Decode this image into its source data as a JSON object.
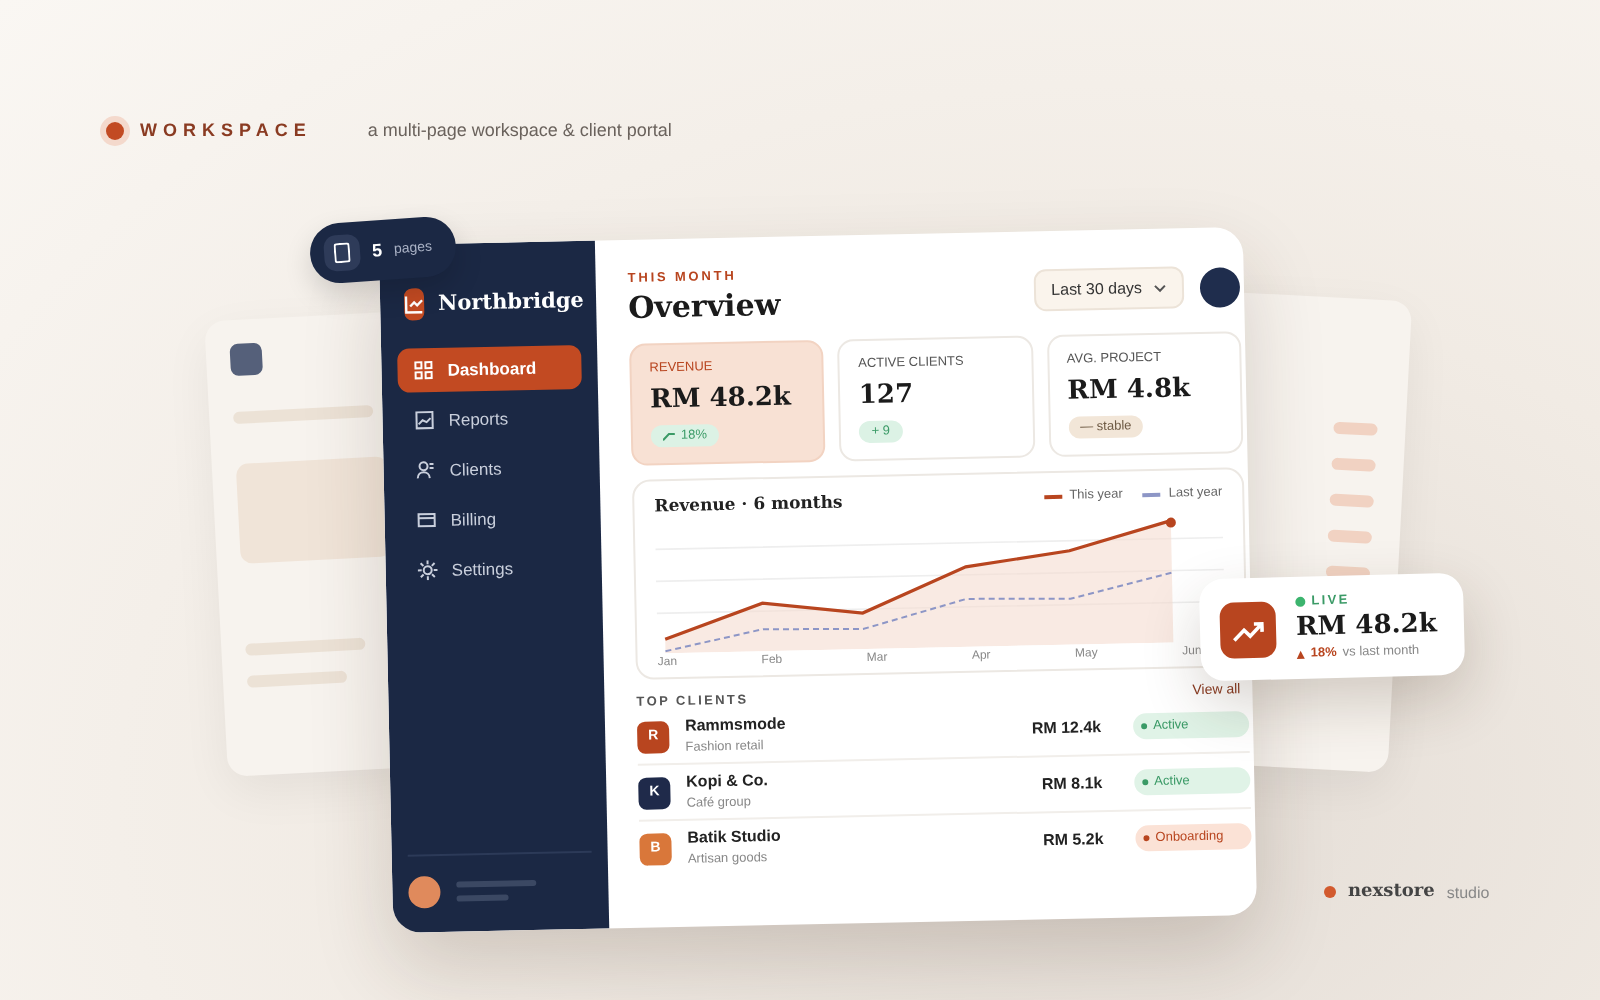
{
  "brand": {
    "label": "WORKSPACE",
    "tagline": "a multi-page workspace & client portal"
  },
  "pages_badge": {
    "count": "5",
    "label": "pages"
  },
  "app": {
    "name": "Northbridge",
    "nav": [
      {
        "label": "Dashboard",
        "selected": true
      },
      {
        "label": "Reports",
        "selected": false
      },
      {
        "label": "Clients",
        "selected": false
      },
      {
        "label": "Billing",
        "selected": false
      },
      {
        "label": "Settings",
        "selected": false
      }
    ]
  },
  "header": {
    "eyebrow": "THIS MONTH",
    "title": "Overview",
    "range": "Last 30 days"
  },
  "kpis": [
    {
      "label": "REVENUE",
      "value": "RM 48.2k",
      "badge": "18%",
      "kind": "up",
      "highlighted": true
    },
    {
      "label": "ACTIVE CLIENTS",
      "value": "127",
      "badge": "+ 9",
      "kind": "plus",
      "highlighted": false
    },
    {
      "label": "AVG. PROJECT",
      "value": "RM 4.8k",
      "badge": "— stable",
      "kind": "flat",
      "highlighted": false
    }
  ],
  "chart": {
    "title": "Revenue · 6 months",
    "legend": [
      "This year",
      "Last year"
    ],
    "months": [
      "Jan",
      "Feb",
      "Mar",
      "Apr",
      "May",
      "Jun"
    ]
  },
  "clients": {
    "heading": "TOP CLIENTS",
    "link": "View all",
    "rows": [
      {
        "initial": "R",
        "name": "Rammsmode",
        "sub": "Fashion retail",
        "amount": "RM 12.4k",
        "status": "Active",
        "kind": "active",
        "color": "#b8451f"
      },
      {
        "initial": "K",
        "name": "Kopi & Co.",
        "sub": "Café group",
        "amount": "RM 8.1k",
        "status": "Active",
        "kind": "active",
        "color": "#1f2a4a"
      },
      {
        "initial": "B",
        "name": "Batik Studio",
        "sub": "Artisan goods",
        "amount": "RM 5.2k",
        "status": "Onboarding",
        "kind": "onboarding",
        "color": "#d9773a"
      }
    ]
  },
  "live": {
    "label": "LIVE",
    "value": "RM 48.2k",
    "change": "18%",
    "note": "vs last month"
  },
  "footer": {
    "name": "nexstore",
    "suffix": "studio"
  }
}
